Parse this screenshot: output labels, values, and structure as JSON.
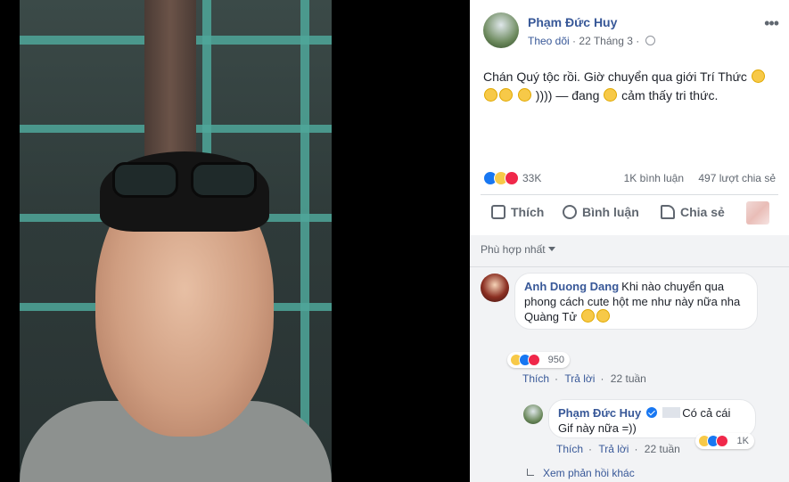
{
  "post": {
    "author": "Phạm Đức Huy",
    "follow_label": "Theo dõi",
    "date": "22 Tháng 3",
    "text_line1": "Chán Quý tộc rồi. Giờ chuyển qua giới Trí Thức",
    "text_line2_suffix": "))))",
    "text_feeling_prefix": "— đang",
    "text_feeling_suffix": "cảm thấy tri thức.",
    "reaction_count": "33K",
    "comment_count": "1K bình luận",
    "share_count": "497 lượt chia sẻ"
  },
  "actions": {
    "like": "Thích",
    "comment": "Bình luận",
    "share": "Chia sẻ"
  },
  "comments": {
    "sort_label": "Phù hợp nhất",
    "items": [
      {
        "name": "Anh Duong Dang",
        "text": "Khi nào chuyển qua phong cách cute hột me như này nữa nha Quàng Tử",
        "reaction_count": "950",
        "like_label": "Thích",
        "reply_label": "Trả lời",
        "time": "22 tuần"
      }
    ],
    "reply": {
      "name": "Phạm Đức Huy",
      "text_line1": "Có cả cái",
      "text_line2": "Gif này nữa =))",
      "reaction_count": "1K",
      "like_label": "Thích",
      "reply_label": "Trả lời",
      "time": "22 tuần"
    },
    "more_replies": "Xem phản hồi khác"
  },
  "colors": {
    "link": "#385898",
    "like": "#1877f2",
    "love": "#f0284a",
    "haha": "#f7c948"
  },
  "icons": [
    "more-icon",
    "globe-icon",
    "like-icon",
    "comment-icon",
    "share-icon",
    "verified-icon",
    "reply-arrow-icon",
    "caret-down-icon"
  ]
}
